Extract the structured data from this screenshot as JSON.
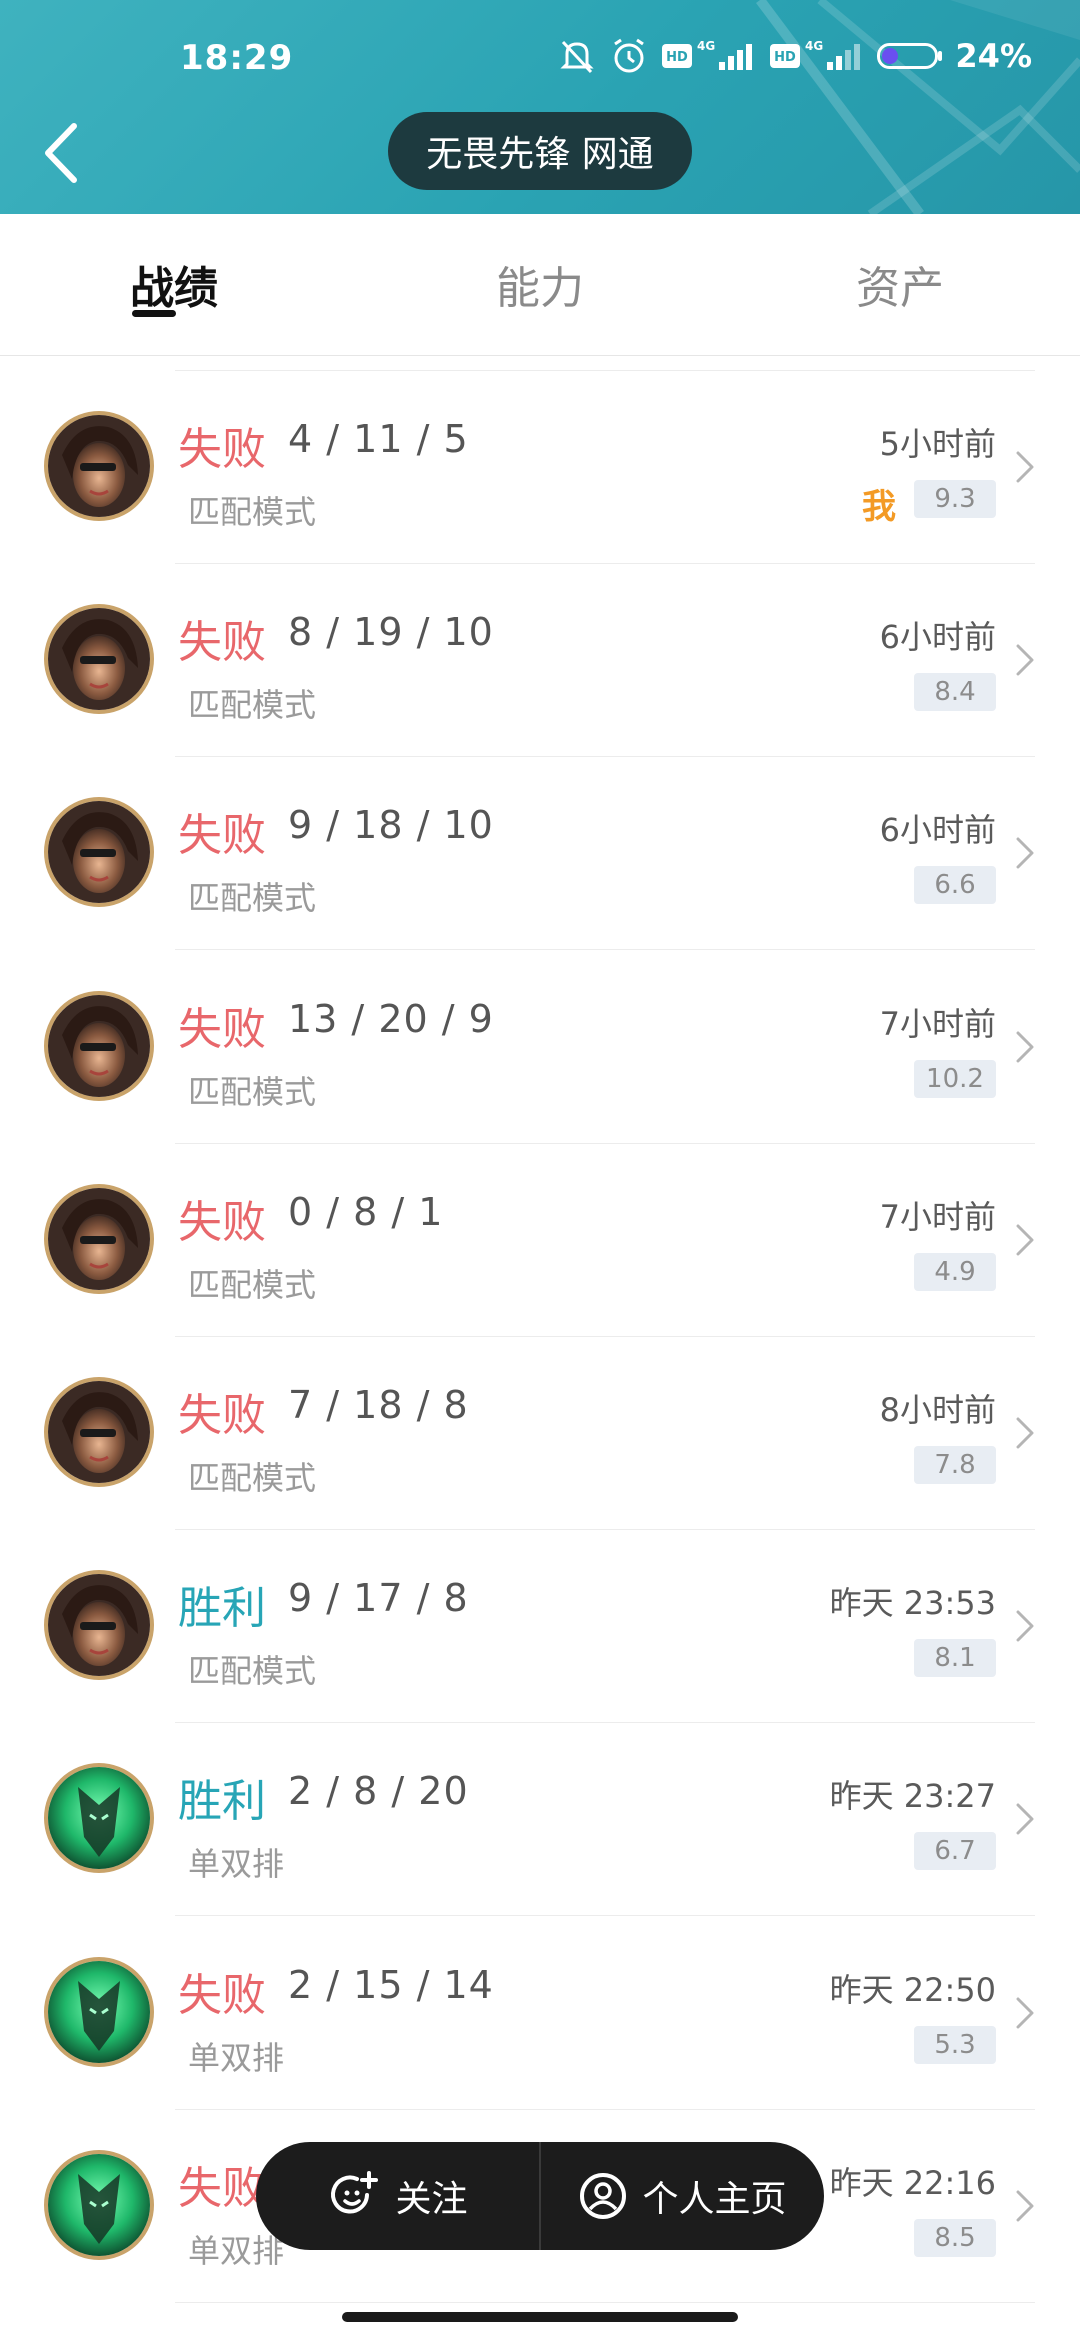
{
  "status_bar": {
    "time": "18:29",
    "battery_percent": "24%",
    "network_1": "4G",
    "network_2": "4G"
  },
  "header": {
    "title": "无畏先锋 网通"
  },
  "tabs": [
    {
      "label": "战绩",
      "active": true
    },
    {
      "label": "能力",
      "active": false
    },
    {
      "label": "资产",
      "active": false
    }
  ],
  "matches": [
    {
      "result": "失败",
      "outcome": "loss",
      "kda": "4 / 11 / 5",
      "mode": "匹配模式",
      "time": "5小时前",
      "score": "9.3",
      "me_badge": "我",
      "champion": "samira"
    },
    {
      "result": "失败",
      "outcome": "loss",
      "kda": "8 / 19 / 10",
      "mode": "匹配模式",
      "time": "6小时前",
      "score": "8.4",
      "me_badge": "",
      "champion": "samira"
    },
    {
      "result": "失败",
      "outcome": "loss",
      "kda": "9 / 18 / 10",
      "mode": "匹配模式",
      "time": "6小时前",
      "score": "6.6",
      "me_badge": "",
      "champion": "samira"
    },
    {
      "result": "失败",
      "outcome": "loss",
      "kda": "13 / 20 / 9",
      "mode": "匹配模式",
      "time": "7小时前",
      "score": "10.2",
      "me_badge": "",
      "champion": "samira"
    },
    {
      "result": "失败",
      "outcome": "loss",
      "kda": "0 / 8 / 1",
      "mode": "匹配模式",
      "time": "7小时前",
      "score": "4.9",
      "me_badge": "",
      "champion": "samira"
    },
    {
      "result": "失败",
      "outcome": "loss",
      "kda": "7 / 18 / 8",
      "mode": "匹配模式",
      "time": "8小时前",
      "score": "7.8",
      "me_badge": "",
      "champion": "samira"
    },
    {
      "result": "胜利",
      "outcome": "win",
      "kda": "9 / 17 / 8",
      "mode": "匹配模式",
      "time": "昨天 23:53",
      "score": "8.1",
      "me_badge": "",
      "champion": "samira"
    },
    {
      "result": "胜利",
      "outcome": "win",
      "kda": "2 / 8 / 20",
      "mode": "单双排",
      "time": "昨天 23:27",
      "score": "6.7",
      "me_badge": "",
      "champion": "thresh"
    },
    {
      "result": "失败",
      "outcome": "loss",
      "kda": "2 / 15 / 14",
      "mode": "单双排",
      "time": "昨天 22:50",
      "score": "5.3",
      "me_badge": "",
      "champion": "thresh"
    },
    {
      "result": "失败",
      "outcome": "loss",
      "kda": "",
      "mode": "单双排",
      "time": "昨天 22:16",
      "score": "8.5",
      "me_badge": "",
      "champion": "thresh"
    }
  ],
  "action_bar": {
    "follow_label": "关注",
    "profile_label": "个人主页"
  },
  "colors": {
    "header_teal": "#2aa3b3",
    "loss_red": "#e8676b",
    "win_teal": "#27a5b6",
    "me_orange": "#f39a25"
  }
}
